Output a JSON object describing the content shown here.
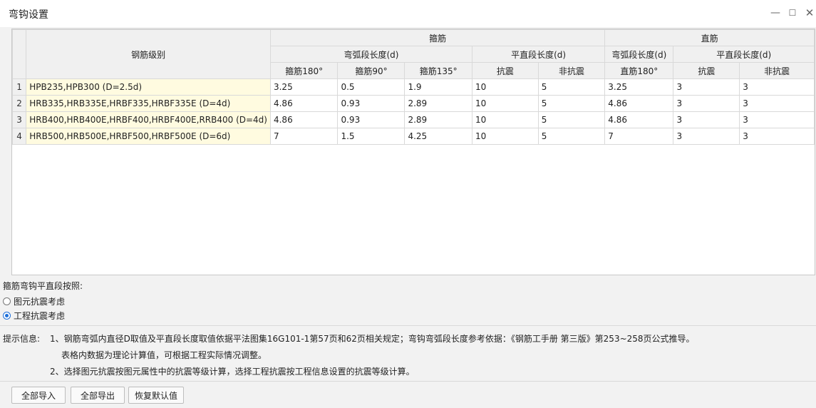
{
  "window": {
    "title": "弯钩设置",
    "minimize": "—",
    "maximize": "☐",
    "close": "✕"
  },
  "table": {
    "grade_header": "钢筋级别",
    "group_stirrup": "箍筋",
    "group_straight": "直筋",
    "sub_arc_length": "弯弧段长度(d)",
    "sub_straight_length": "平直段长度(d)",
    "sub_arc_length_2": "弯弧段长度(d)",
    "sub_straight_length_2": "平直段长度(d)",
    "col_stirrup_180": "箍筋180°",
    "col_stirrup_90": "箍筋90°",
    "col_stirrup_135": "箍筋135°",
    "col_seismic": "抗震",
    "col_nonseismic": "非抗震",
    "col_straight_180": "直筋180°",
    "col_seismic_2": "抗震",
    "col_nonseismic_2": "非抗震",
    "rows": [
      {
        "num": "1",
        "grade": "HPB235,HPB300 (D=2.5d)",
        "s180": "3.25",
        "s90": "0.5",
        "s135": "1.9",
        "seis": "10",
        "nonseis": "5",
        "z180": "3.25",
        "zseis": "3",
        "znonseis": "3"
      },
      {
        "num": "2",
        "grade": "HRB335,HRB335E,HRBF335,HRBF335E (D=4d)",
        "s180": "4.86",
        "s90": "0.93",
        "s135": "2.89",
        "seis": "10",
        "nonseis": "5",
        "z180": "4.86",
        "zseis": "3",
        "znonseis": "3"
      },
      {
        "num": "3",
        "grade": "HRB400,HRB400E,HRBF400,HRBF400E,RRB400 (D=4d)",
        "s180": "4.86",
        "s90": "0.93",
        "s135": "2.89",
        "seis": "10",
        "nonseis": "5",
        "z180": "4.86",
        "zseis": "3",
        "znonseis": "3"
      },
      {
        "num": "4",
        "grade": "HRB500,HRB500E,HRBF500,HRBF500E (D=6d)",
        "s180": "7",
        "s90": "1.5",
        "s135": "4.25",
        "seis": "10",
        "nonseis": "5",
        "z180": "7",
        "zseis": "3",
        "znonseis": "3"
      }
    ]
  },
  "options": {
    "label": "箍筋弯钩平直段按照:",
    "radio1": "图元抗震考虑",
    "radio2": "工程抗震考虑",
    "selected": "工程抗震考虑"
  },
  "hints": {
    "label": "提示信息:",
    "line1": "1、钢筋弯弧内直径D取值及平直段长度取值依据平法图集16G101-1第57页和62页相关规定；弯钩弯弧段长度参考依据：《钢筋工手册 第三版》第253~258页公式推导。",
    "line2": "表格内数据为理论计算值，可根据工程实际情况调整。",
    "line3": "2、选择图元抗震按图元属性中的抗震等级计算，选择工程抗震按工程信息设置的抗震等级计算。"
  },
  "buttons": {
    "import_all": "全部导入",
    "export_all": "全部导出",
    "restore_default": "恢复默认值"
  },
  "colors": {
    "grade_cell_bg": "#fffbe0",
    "radio_accent": "#1e6fd9",
    "header_bg": "#f0f0f0"
  }
}
